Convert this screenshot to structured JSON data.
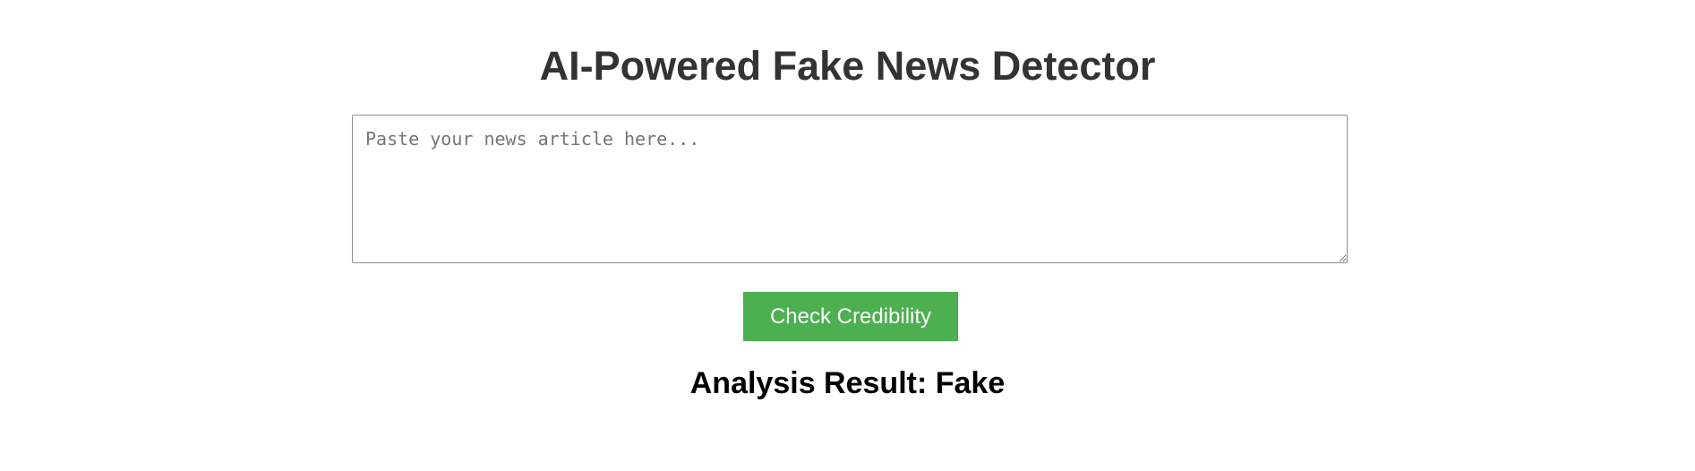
{
  "header": {
    "title": "AI-Powered Fake News Detector"
  },
  "form": {
    "article_value": "",
    "article_placeholder": "Paste your news article here...",
    "submit_label": "Check Credibility"
  },
  "result": {
    "text": "Analysis Result: Fake"
  },
  "colors": {
    "button_bg": "#4caf50",
    "title_color": "#333333"
  }
}
